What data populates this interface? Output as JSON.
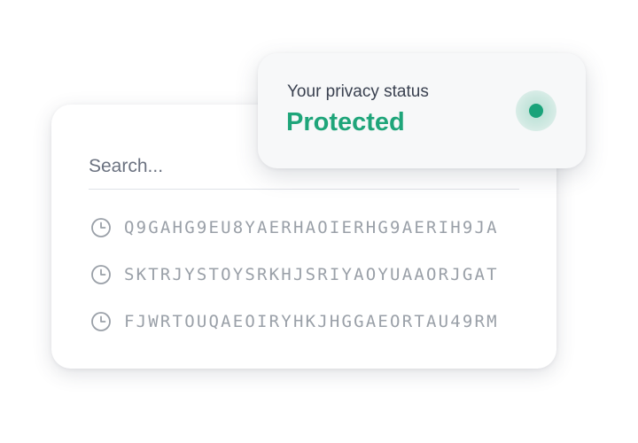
{
  "privacy": {
    "caption": "Your privacy status",
    "status": "Protected",
    "status_color": "#1fa57a"
  },
  "search": {
    "placeholder": "Search..."
  },
  "history": {
    "icon": "clock-icon",
    "items": [
      "Q9GAHG9EU8YAERHAOIERHG9AERIH9JA",
      "SKTRJYSTOYSRKHJSRIYAOYUAAORJGAT",
      "FJWRTOUQAEOIRYHKJHGGAEORTAU49RM"
    ]
  }
}
